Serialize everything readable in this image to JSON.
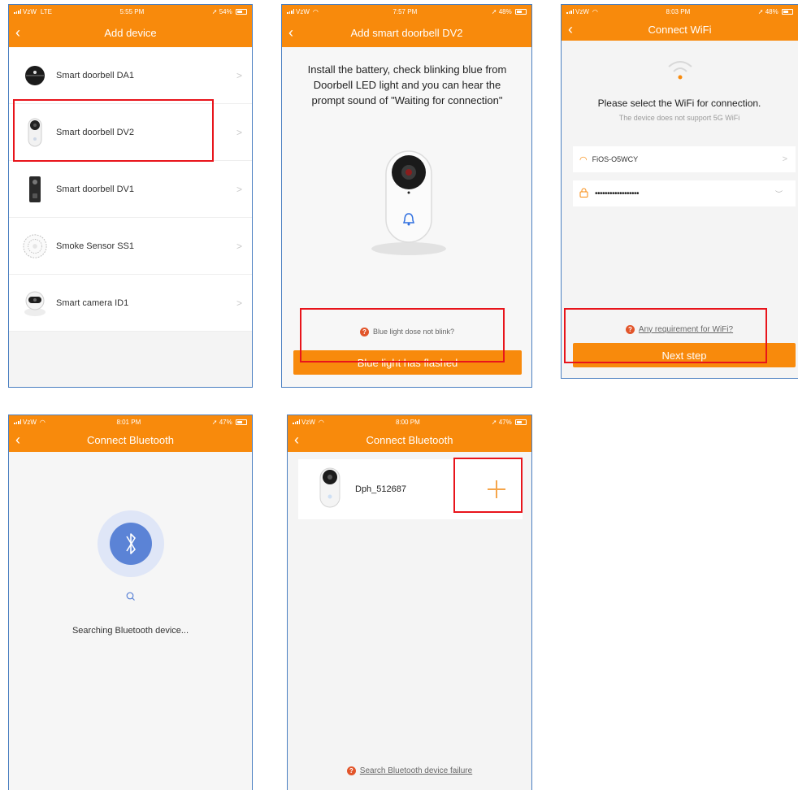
{
  "colors": {
    "accent": "#f88a0c",
    "highlight": "#e8141b",
    "bluetooth": "#5b83d6",
    "help": "#e2552a"
  },
  "screen1": {
    "status": {
      "carrier": "VzW",
      "network": "LTE",
      "time": "5:55 PM",
      "battery": "54%"
    },
    "title": "Add device",
    "devices": [
      {
        "name": "Smart doorbell DA1",
        "icon": "doorbell-da1-icon"
      },
      {
        "name": "Smart doorbell DV2",
        "icon": "doorbell-dv2-icon"
      },
      {
        "name": "Smart doorbell DV1",
        "icon": "doorbell-dv1-icon"
      },
      {
        "name": "Smoke Sensor SS1",
        "icon": "smoke-sensor-icon"
      },
      {
        "name": "Smart camera ID1",
        "icon": "smart-camera-icon"
      }
    ]
  },
  "screen2": {
    "status": {
      "carrier": "VzW",
      "time": "7:57 PM",
      "battery": "48%"
    },
    "title": "Add smart doorbell DV2",
    "instruction": "Install the battery, check blinking blue from Doorbell LED light and you can hear the prompt sound of \"Waiting for connection\"",
    "help": "Blue light dose not blink?",
    "button": "Blue light has flashed"
  },
  "screen3": {
    "status": {
      "carrier": "VzW",
      "time": "8:03 PM",
      "battery": "48%"
    },
    "title": "Connect WiFi",
    "heading": "Please select the WiFi for connection.",
    "subheading": "The device does not support 5G WiFi",
    "ssid": "FiOS-O5WCY",
    "password": "••••••••••••••••••",
    "help": "Any requirement for WiFi?",
    "button": "Next step"
  },
  "screen4": {
    "status": {
      "carrier": "VzW",
      "time": "8:01 PM",
      "battery": "47%"
    },
    "title": "Connect Bluetooth",
    "searching": "Searching Bluetooth device..."
  },
  "screen5": {
    "status": {
      "carrier": "VzW",
      "time": "8:00 PM",
      "battery": "47%"
    },
    "title": "Connect Bluetooth",
    "device": "Dph_512687",
    "help": "Search Bluetooth device failure"
  }
}
